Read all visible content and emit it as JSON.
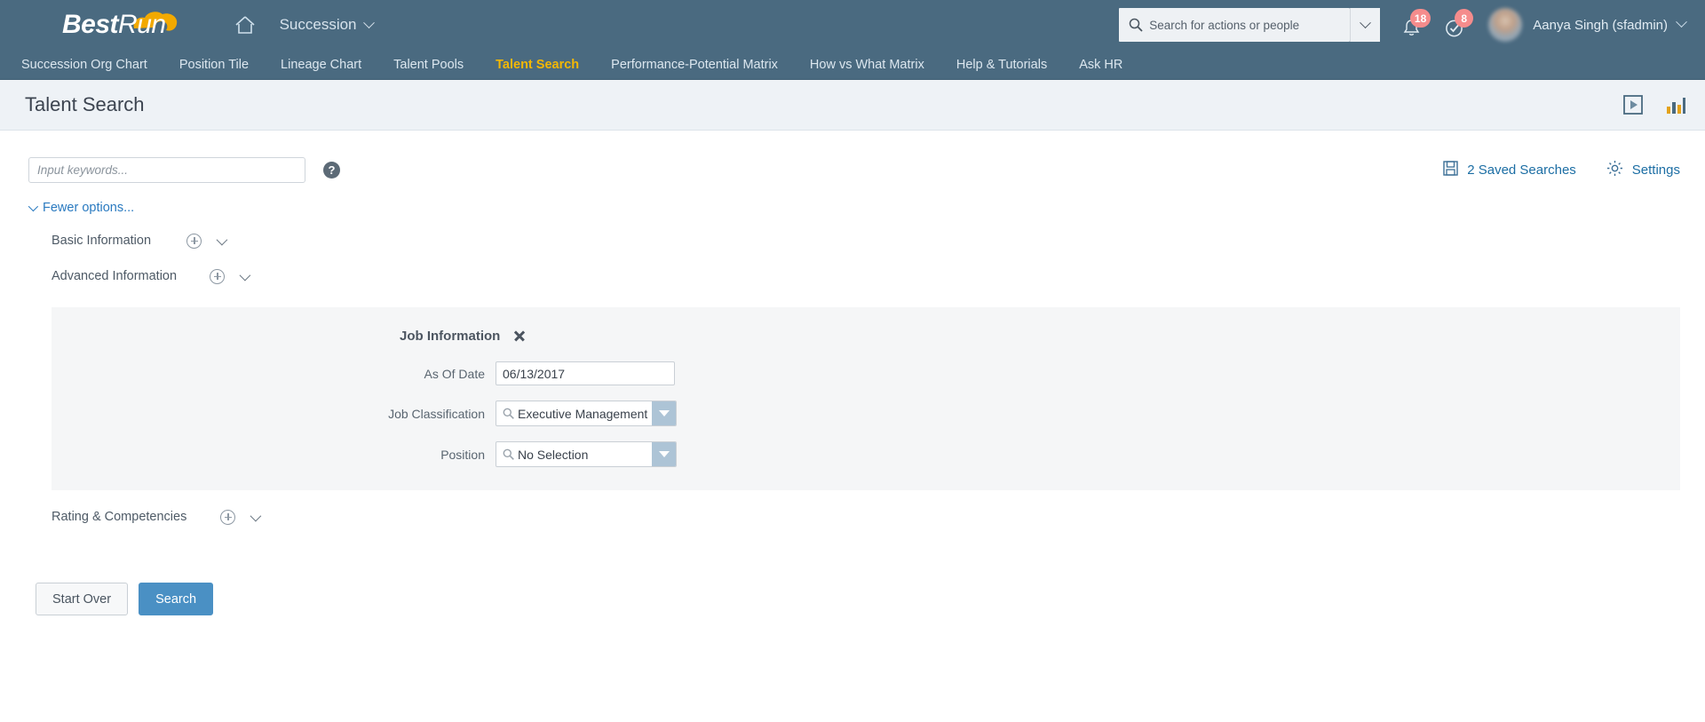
{
  "header": {
    "logo_bold": "Best",
    "logo_thin": "Run",
    "home_icon": "home-icon",
    "module": "Succession",
    "search": {
      "placeholder": "Search for actions or people",
      "icon": "search-icon",
      "dropdown_icon": "chevron-down-icon"
    },
    "notifications": {
      "icon": "bell-icon",
      "count": "18"
    },
    "todos": {
      "icon": "check-circle-icon",
      "count": "8"
    },
    "user": {
      "name": "Aanya Singh (sfadmin)",
      "avatar": "avatar"
    }
  },
  "nav": {
    "items": [
      {
        "label": "Succession Org Chart",
        "active": false
      },
      {
        "label": "Position Tile",
        "active": false
      },
      {
        "label": "Lineage Chart",
        "active": false
      },
      {
        "label": "Talent Pools",
        "active": false
      },
      {
        "label": "Talent Search",
        "active": true
      },
      {
        "label": "Performance-Potential Matrix",
        "active": false
      },
      {
        "label": "How vs What Matrix",
        "active": false
      },
      {
        "label": "Help & Tutorials",
        "active": false
      },
      {
        "label": "Ask HR",
        "active": false
      }
    ]
  },
  "page": {
    "title": "Talent Search",
    "actions": [
      {
        "name": "play-icon"
      },
      {
        "name": "bar-chart-icon"
      }
    ]
  },
  "search_panel": {
    "keyword_placeholder": "Input keywords...",
    "keyword_value": "",
    "help_icon": "question-mark-icon",
    "saved_searches": {
      "label": "2 Saved Searches",
      "icon": "save-icon"
    },
    "settings": {
      "label": "Settings",
      "icon": "gear-icon"
    },
    "fewer_options": "Fewer options...",
    "sections": [
      {
        "label": "Basic Information"
      },
      {
        "label": "Advanced Information"
      },
      {
        "label": "Rating & Competencies"
      }
    ]
  },
  "job_information": {
    "title": "Job Information",
    "close_icon": "close-icon",
    "fields": [
      {
        "label": "As Of Date",
        "value": "06/13/2017",
        "type": "text"
      },
      {
        "label": "Job Classification",
        "value": "Executive Management (",
        "type": "picker"
      },
      {
        "label": "Position",
        "value": "No Selection",
        "type": "picker"
      }
    ]
  },
  "buttons": {
    "start_over": "Start Over",
    "search": "Search"
  },
  "colors": {
    "header_bg": "#4a6a80",
    "accent_link": "#1c6ea4",
    "active_tab": "#f2b705",
    "primary_button": "#4a90c4",
    "badge": "#f58c8c"
  }
}
